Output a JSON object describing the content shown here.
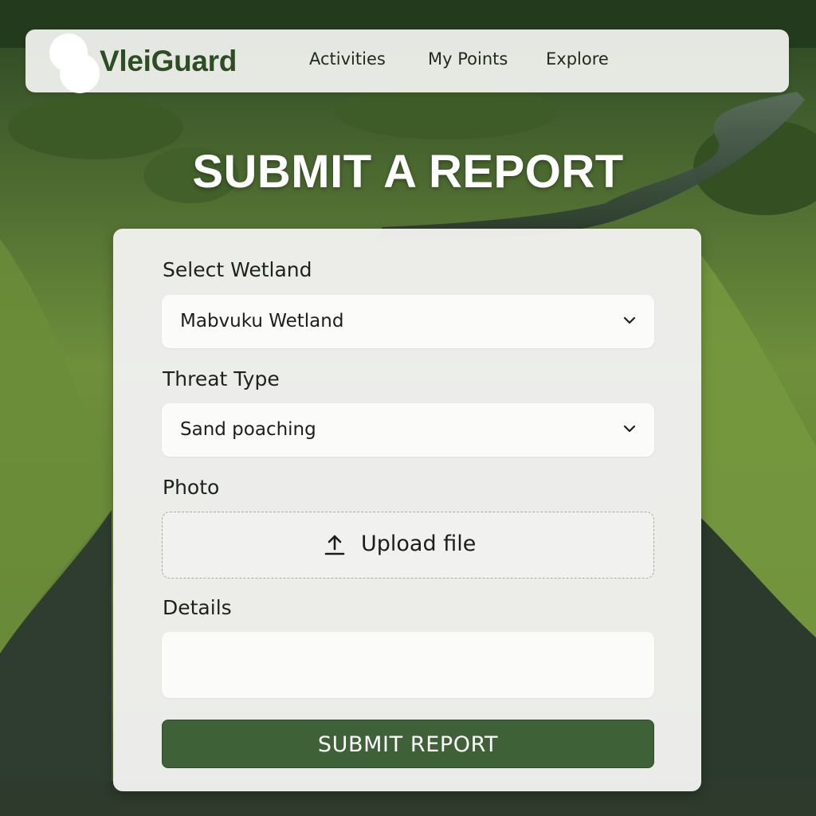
{
  "header": {
    "brand": "VleiGuard",
    "nav": [
      "Activities",
      "My Points",
      "Explore"
    ]
  },
  "page": {
    "title": "SUBMIT A REPORT"
  },
  "form": {
    "wetland_label": "Select Wetland",
    "wetland_value": "Mabvuku Wetland",
    "threat_label": "Threat Type",
    "threat_value": "Sand poaching",
    "photo_label": "Photo",
    "upload_label": "Upload file",
    "details_label": "Details",
    "details_value": "",
    "submit_label": "SUBMIT REPORT"
  },
  "icons": {
    "select_chevron": "chevron-down-icon",
    "upload": "upload-icon",
    "logo": "logo-mark"
  },
  "colors": {
    "brand_green": "#2e4d25",
    "submit_green": "#3e6137",
    "card_bg": "#f1f1f0",
    "title_white": "#ffffff"
  }
}
